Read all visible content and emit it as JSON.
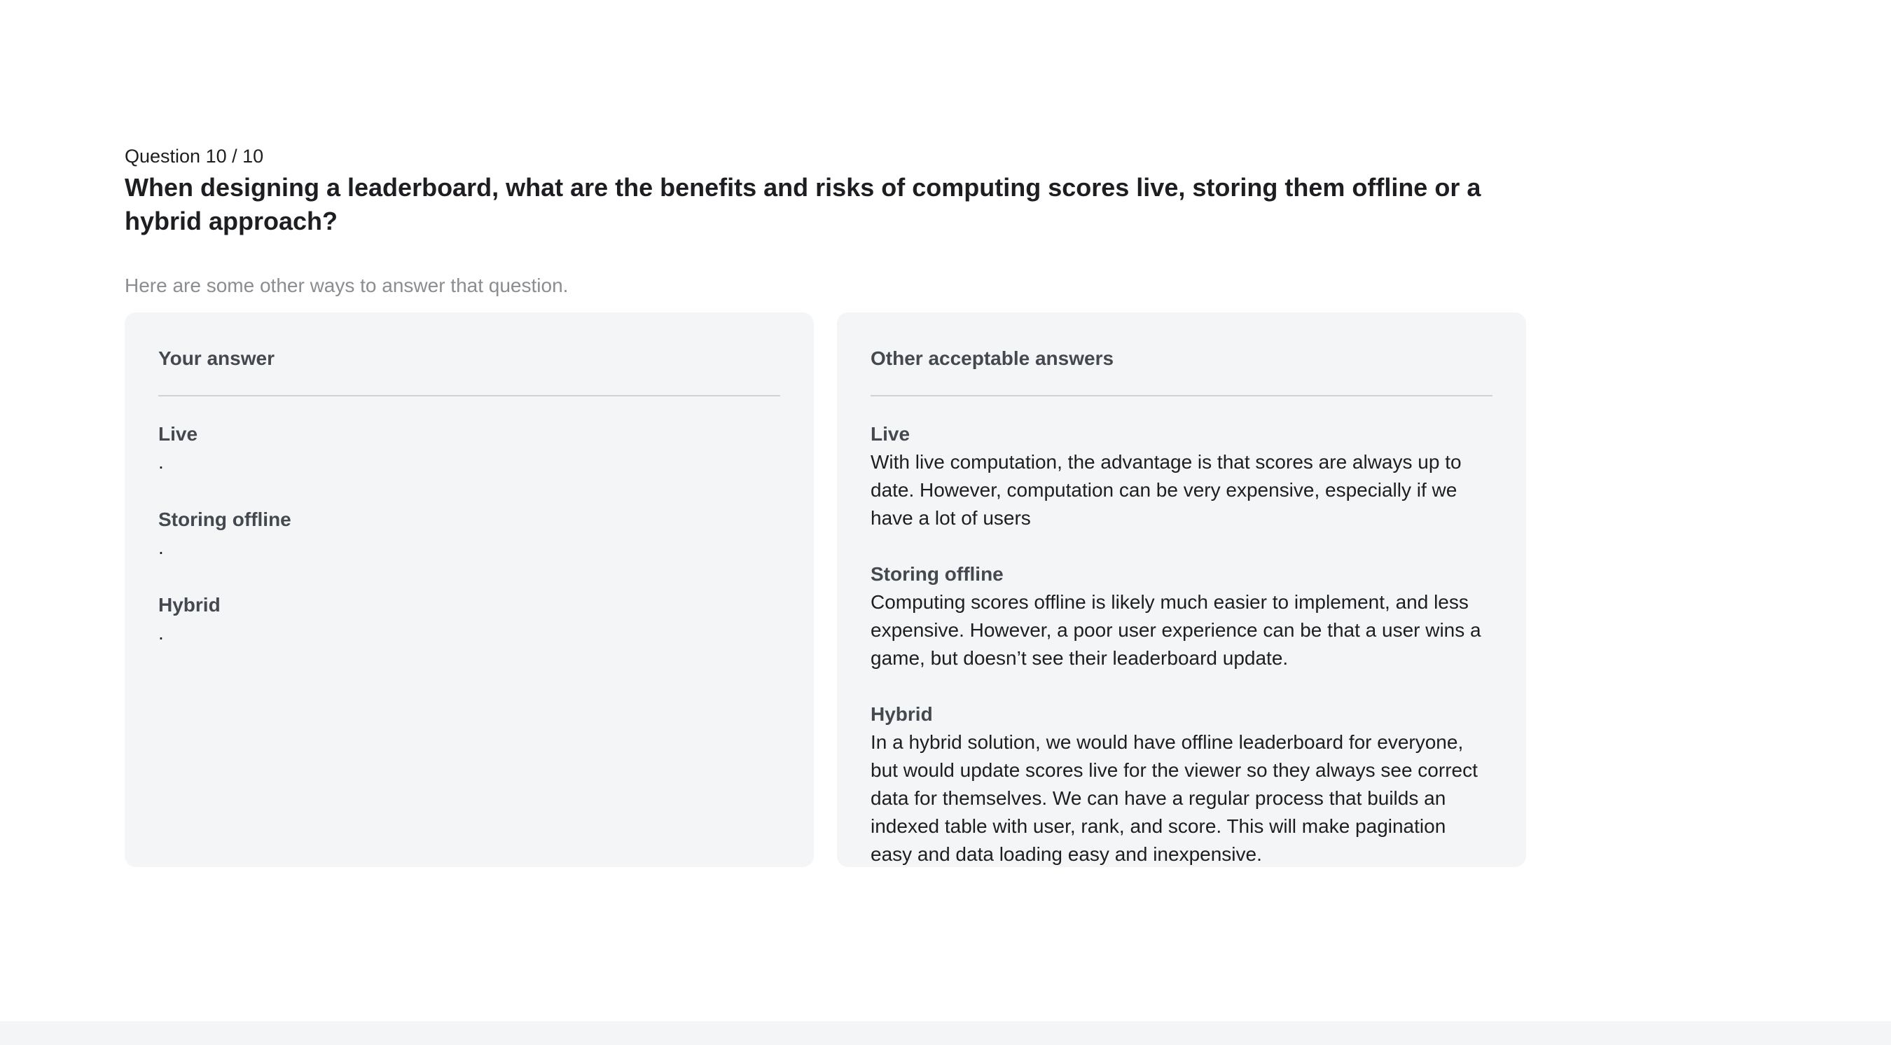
{
  "question": {
    "counter": "Question 10 / 10",
    "text": "When designing a leaderboard, what are the benefits and risks of computing scores live, storing them offline or a hybrid approach?",
    "hint": "Here are some other ways to answer that question."
  },
  "your_answer": {
    "title": "Your answer",
    "sections": [
      {
        "heading": "Live",
        "body": "."
      },
      {
        "heading": "Storing offline",
        "body": "."
      },
      {
        "heading": "Hybrid",
        "body": "."
      }
    ]
  },
  "other_answers": {
    "title": "Other acceptable answers",
    "sections": [
      {
        "heading": "Live",
        "body": "With live computation, the advantage is that scores are always up to date. However, computation can be very expensive, especially if we have a lot of users"
      },
      {
        "heading": "Storing offline",
        "body": "Computing scores offline is likely much easier to implement, and less expensive. However, a poor user experience can be that a user wins a game, but doesn’t see their leaderboard update."
      },
      {
        "heading": "Hybrid",
        "body": "In a hybrid solution, we would have offline leaderboard for everyone, but would update scores live for the viewer so they always see correct data for themselves. We can have a regular process that builds an indexed table with user, rank, and score. This will make pagination easy and data loading easy and inexpensive."
      }
    ]
  }
}
